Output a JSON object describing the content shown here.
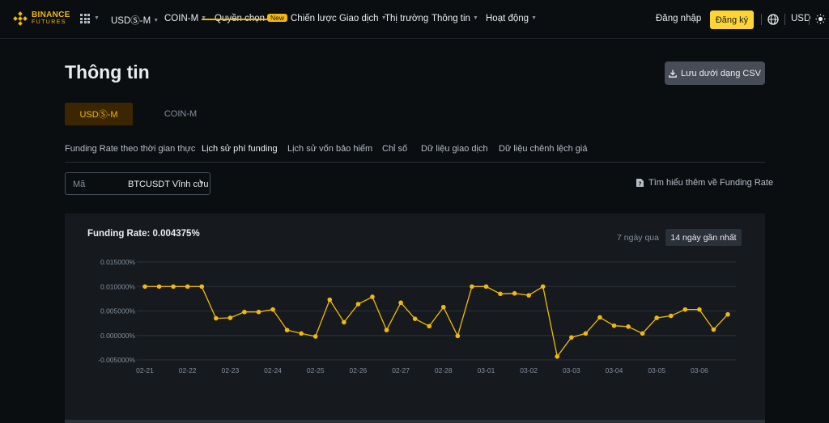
{
  "header": {
    "logo_line1": "BINANCE",
    "logo_line2": "FUTURES",
    "nav": [
      {
        "label": "USDⓈ-M",
        "has_caret": true
      },
      {
        "label": "COIN-M",
        "has_caret": true
      },
      {
        "label": "Quyền chọn",
        "badge": "New"
      },
      {
        "label": "Chiến lược Giao dịch",
        "has_caret": true
      },
      {
        "label": "Thị trường"
      },
      {
        "label": "Thông tin",
        "has_caret": true
      },
      {
        "label": "Hoạt động",
        "has_caret": true
      }
    ],
    "login": "Đăng nhập",
    "signup": "Đăng ký",
    "currency": "USD"
  },
  "page": {
    "title": "Thông tin",
    "csv_button": "Lưu dưới dạng CSV",
    "segments": [
      "USDⓈ-M",
      "COIN-M"
    ],
    "active_segment": 0,
    "tabs": [
      "Funding Rate theo thời gian thực",
      "Lịch sử phí funding",
      "Lịch sử vốn bảo hiểm",
      "Chỉ số",
      "Dữ liệu giao dịch",
      "Dữ liệu chênh lệch giá"
    ],
    "active_tab": 1,
    "symbol_label": "Mã",
    "symbol_value": "BTCUSDT Vĩnh cửu",
    "learn_more": "Tìm hiểu thêm về Funding Rate",
    "funding_rate_label": "Funding Rate: 0.004375%",
    "range_options": [
      "7 ngày qua",
      "14 ngày gần nhất"
    ],
    "active_range": 1
  },
  "colors": {
    "accent": "#f0b90b",
    "background": "#0b0e11",
    "panel": "#161a1e"
  },
  "chart_data": {
    "type": "line",
    "ylim": [
      -0.005,
      0.015
    ],
    "yticks": [
      "0.015000%",
      "0.010000%",
      "0.005000%",
      "0.000000%",
      "-0.005000%"
    ],
    "ytick_values": [
      0.015,
      0.01,
      0.005,
      0.0,
      -0.005
    ],
    "xtick_labels": [
      "02-21",
      "02-22",
      "02-23",
      "02-24",
      "02-25",
      "02-26",
      "02-27",
      "02-28",
      "03-01",
      "03-02",
      "03-03",
      "03-04",
      "03-05",
      "03-06"
    ],
    "series": [
      {
        "values": [
          0.01,
          0.01,
          0.01,
          0.01,
          0.01,
          0.0035,
          0.0036,
          0.0048,
          0.0048,
          0.0053,
          0.0011,
          0.0004,
          -0.0002,
          0.0073,
          0.0027,
          0.0064,
          0.0079,
          0.0011,
          0.0067,
          0.0034,
          0.0019,
          0.0058,
          -0.0001,
          0.01,
          0.01,
          0.0085,
          0.0086,
          0.0082,
          0.01,
          -0.0043,
          -0.0004,
          0.0004,
          0.0037,
          0.002,
          0.0018,
          0.0004,
          0.0036,
          0.004,
          0.0053,
          0.0053,
          0.0012,
          0.0043
        ]
      }
    ]
  }
}
